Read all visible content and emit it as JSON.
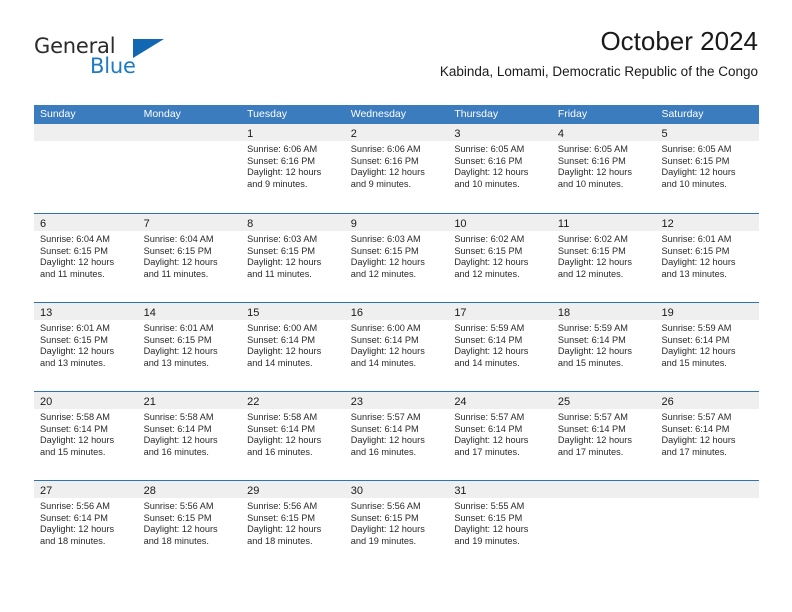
{
  "brand": {
    "word_one": "General",
    "word_two": "Blue",
    "flag_icon": "triangle-flag-icon"
  },
  "header": {
    "title": "October 2024",
    "location": "Kabinda, Lomami, Democratic Republic of the Congo"
  },
  "colors": {
    "header_blue": "#3b7cbf",
    "row_divider_blue": "#2f72b5",
    "day_band_gray": "#efeff0",
    "brand_blue": "#1f7ac4",
    "flag_blue": "#1167b1"
  },
  "calendar": {
    "weekday_headers": [
      "Sunday",
      "Monday",
      "Tuesday",
      "Wednesday",
      "Thursday",
      "Friday",
      "Saturday"
    ],
    "weeks": [
      [
        {
          "day": "",
          "empty": true
        },
        {
          "day": "",
          "empty": true
        },
        {
          "day": "1",
          "sunrise": "Sunrise: 6:06 AM",
          "sunset": "Sunset: 6:16 PM",
          "daylight": "Daylight: 12 hours and 9 minutes."
        },
        {
          "day": "2",
          "sunrise": "Sunrise: 6:06 AM",
          "sunset": "Sunset: 6:16 PM",
          "daylight": "Daylight: 12 hours and 9 minutes."
        },
        {
          "day": "3",
          "sunrise": "Sunrise: 6:05 AM",
          "sunset": "Sunset: 6:16 PM",
          "daylight": "Daylight: 12 hours and 10 minutes."
        },
        {
          "day": "4",
          "sunrise": "Sunrise: 6:05 AM",
          "sunset": "Sunset: 6:16 PM",
          "daylight": "Daylight: 12 hours and 10 minutes."
        },
        {
          "day": "5",
          "sunrise": "Sunrise: 6:05 AM",
          "sunset": "Sunset: 6:15 PM",
          "daylight": "Daylight: 12 hours and 10 minutes."
        }
      ],
      [
        {
          "day": "6",
          "sunrise": "Sunrise: 6:04 AM",
          "sunset": "Sunset: 6:15 PM",
          "daylight": "Daylight: 12 hours and 11 minutes."
        },
        {
          "day": "7",
          "sunrise": "Sunrise: 6:04 AM",
          "sunset": "Sunset: 6:15 PM",
          "daylight": "Daylight: 12 hours and 11 minutes."
        },
        {
          "day": "8",
          "sunrise": "Sunrise: 6:03 AM",
          "sunset": "Sunset: 6:15 PM",
          "daylight": "Daylight: 12 hours and 11 minutes."
        },
        {
          "day": "9",
          "sunrise": "Sunrise: 6:03 AM",
          "sunset": "Sunset: 6:15 PM",
          "daylight": "Daylight: 12 hours and 12 minutes."
        },
        {
          "day": "10",
          "sunrise": "Sunrise: 6:02 AM",
          "sunset": "Sunset: 6:15 PM",
          "daylight": "Daylight: 12 hours and 12 minutes."
        },
        {
          "day": "11",
          "sunrise": "Sunrise: 6:02 AM",
          "sunset": "Sunset: 6:15 PM",
          "daylight": "Daylight: 12 hours and 12 minutes."
        },
        {
          "day": "12",
          "sunrise": "Sunrise: 6:01 AM",
          "sunset": "Sunset: 6:15 PM",
          "daylight": "Daylight: 12 hours and 13 minutes."
        }
      ],
      [
        {
          "day": "13",
          "sunrise": "Sunrise: 6:01 AM",
          "sunset": "Sunset: 6:15 PM",
          "daylight": "Daylight: 12 hours and 13 minutes."
        },
        {
          "day": "14",
          "sunrise": "Sunrise: 6:01 AM",
          "sunset": "Sunset: 6:15 PM",
          "daylight": "Daylight: 12 hours and 13 minutes."
        },
        {
          "day": "15",
          "sunrise": "Sunrise: 6:00 AM",
          "sunset": "Sunset: 6:14 PM",
          "daylight": "Daylight: 12 hours and 14 minutes."
        },
        {
          "day": "16",
          "sunrise": "Sunrise: 6:00 AM",
          "sunset": "Sunset: 6:14 PM",
          "daylight": "Daylight: 12 hours and 14 minutes."
        },
        {
          "day": "17",
          "sunrise": "Sunrise: 5:59 AM",
          "sunset": "Sunset: 6:14 PM",
          "daylight": "Daylight: 12 hours and 14 minutes."
        },
        {
          "day": "18",
          "sunrise": "Sunrise: 5:59 AM",
          "sunset": "Sunset: 6:14 PM",
          "daylight": "Daylight: 12 hours and 15 minutes."
        },
        {
          "day": "19",
          "sunrise": "Sunrise: 5:59 AM",
          "sunset": "Sunset: 6:14 PM",
          "daylight": "Daylight: 12 hours and 15 minutes."
        }
      ],
      [
        {
          "day": "20",
          "sunrise": "Sunrise: 5:58 AM",
          "sunset": "Sunset: 6:14 PM",
          "daylight": "Daylight: 12 hours and 15 minutes."
        },
        {
          "day": "21",
          "sunrise": "Sunrise: 5:58 AM",
          "sunset": "Sunset: 6:14 PM",
          "daylight": "Daylight: 12 hours and 16 minutes."
        },
        {
          "day": "22",
          "sunrise": "Sunrise: 5:58 AM",
          "sunset": "Sunset: 6:14 PM",
          "daylight": "Daylight: 12 hours and 16 minutes."
        },
        {
          "day": "23",
          "sunrise": "Sunrise: 5:57 AM",
          "sunset": "Sunset: 6:14 PM",
          "daylight": "Daylight: 12 hours and 16 minutes."
        },
        {
          "day": "24",
          "sunrise": "Sunrise: 5:57 AM",
          "sunset": "Sunset: 6:14 PM",
          "daylight": "Daylight: 12 hours and 17 minutes."
        },
        {
          "day": "25",
          "sunrise": "Sunrise: 5:57 AM",
          "sunset": "Sunset: 6:14 PM",
          "daylight": "Daylight: 12 hours and 17 minutes."
        },
        {
          "day": "26",
          "sunrise": "Sunrise: 5:57 AM",
          "sunset": "Sunset: 6:14 PM",
          "daylight": "Daylight: 12 hours and 17 minutes."
        }
      ],
      [
        {
          "day": "27",
          "sunrise": "Sunrise: 5:56 AM",
          "sunset": "Sunset: 6:14 PM",
          "daylight": "Daylight: 12 hours and 18 minutes."
        },
        {
          "day": "28",
          "sunrise": "Sunrise: 5:56 AM",
          "sunset": "Sunset: 6:15 PM",
          "daylight": "Daylight: 12 hours and 18 minutes."
        },
        {
          "day": "29",
          "sunrise": "Sunrise: 5:56 AM",
          "sunset": "Sunset: 6:15 PM",
          "daylight": "Daylight: 12 hours and 18 minutes."
        },
        {
          "day": "30",
          "sunrise": "Sunrise: 5:56 AM",
          "sunset": "Sunset: 6:15 PM",
          "daylight": "Daylight: 12 hours and 19 minutes."
        },
        {
          "day": "31",
          "sunrise": "Sunrise: 5:55 AM",
          "sunset": "Sunset: 6:15 PM",
          "daylight": "Daylight: 12 hours and 19 minutes."
        },
        {
          "day": "",
          "empty": true
        },
        {
          "day": "",
          "empty": true
        }
      ]
    ]
  }
}
